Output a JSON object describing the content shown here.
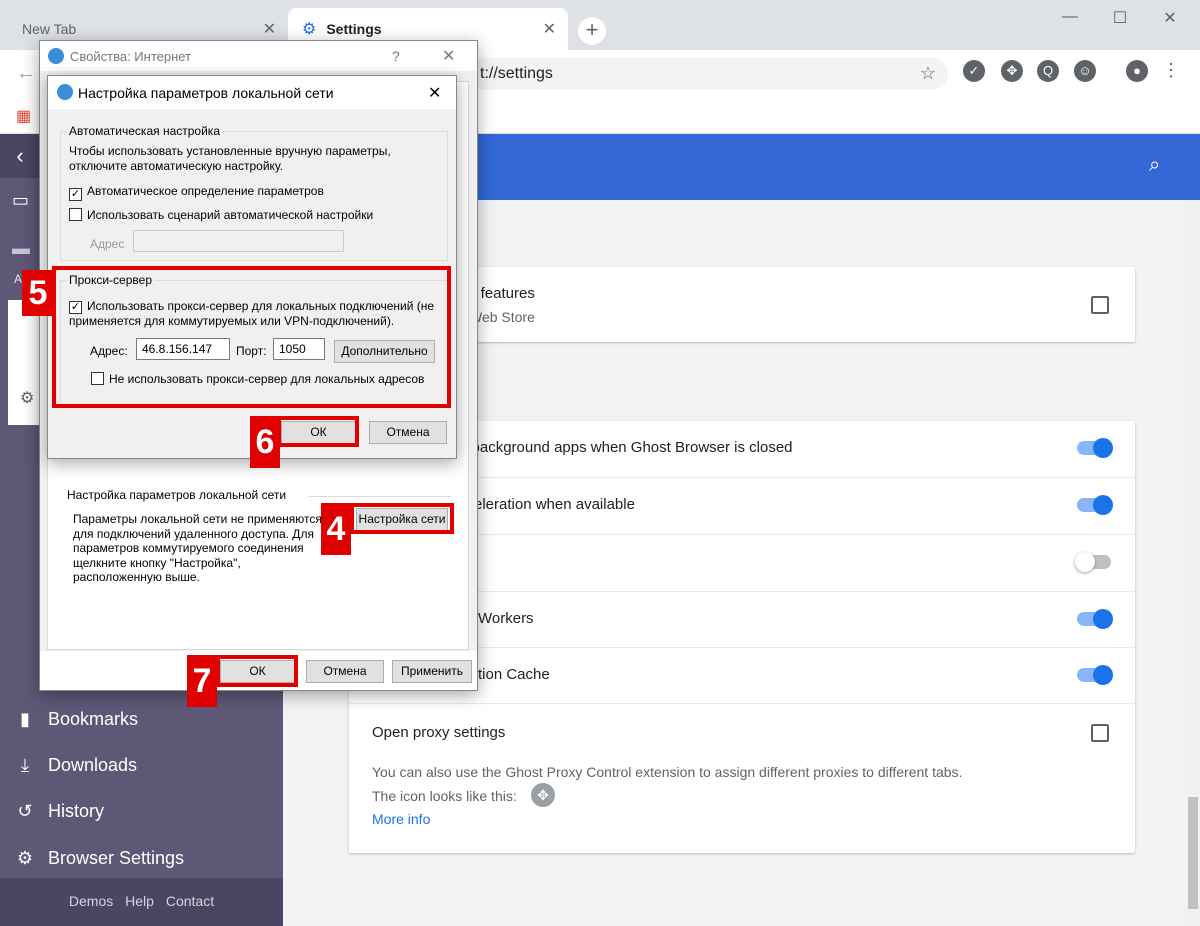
{
  "tabs": [
    {
      "label": "New Tab"
    },
    {
      "label": "Settings"
    }
  ],
  "omnibox": {
    "url": "t://settings"
  },
  "sidebar": {
    "items": [
      {
        "label": "Bookmarks",
        "icon": "bookmark-icon"
      },
      {
        "label": "Downloads",
        "icon": "download-icon"
      },
      {
        "label": "History",
        "icon": "history-icon"
      },
      {
        "label": "Browser Settings",
        "icon": "gear-icon"
      }
    ],
    "partial_label": "Al",
    "footer": [
      "Demos",
      "Help",
      "Contact"
    ]
  },
  "settings": {
    "extensions_card": {
      "title": "y features",
      "subtitle": "Web Store"
    },
    "system_rows": [
      {
        "label": "g background apps when Ghost Browser is closed",
        "enabled": true
      },
      {
        "label": "cceleration when available",
        "enabled": true
      },
      {
        "label": "",
        "enabled": false
      },
      {
        "label": "Workers",
        "enabled": true
      },
      {
        "label": "tion Cache",
        "enabled": true
      }
    ],
    "proxy": {
      "title": "Open proxy settings",
      "desc1": "You can also use the Ghost Proxy Control extension to assign different proxies to different tabs.",
      "desc2": "The icon looks like this:",
      "more_info": "More info"
    }
  },
  "inet_dialog": {
    "title": "Свойства: Интернет",
    "help": "?",
    "lan_group_label": "Настройка параметров локальной сети",
    "lan_desc": "Параметры локальной сети не применяются для подключений удаленного доступа. Для параметров коммутируемого соединения щелкните кнопку \"Настройка\", расположенную выше.",
    "lan_button": "Настройка сети",
    "ok": "ОК",
    "cancel": "Отмена",
    "apply": "Применить"
  },
  "lan_dialog": {
    "title": "Настройка параметров локальной сети",
    "auto_group": "Автоматическая настройка",
    "auto_desc": "Чтобы использовать установленные вручную параметры, отключите автоматическую настройку.",
    "auto_detect": {
      "label": "Автоматическое определение параметров",
      "checked": true
    },
    "auto_script": {
      "label": "Использовать сценарий автоматической настройки",
      "checked": false
    },
    "address_label": "Адрес",
    "proxy_group": "Прокси-сервер",
    "use_proxy": {
      "label": "Использовать прокси-сервер для локальных подключений (не применяется для коммутируемых или VPN-подключений).",
      "checked": true
    },
    "proxy_address_label": "Адрес:",
    "proxy_address": "46.8.156.147",
    "port_label": "Порт:",
    "port": "1050",
    "advanced": "Дополнительно",
    "bypass_local": {
      "label": "Не использовать прокси-сервер для локальных адресов",
      "checked": false
    },
    "ok": "ОК",
    "cancel": "Отмена"
  },
  "step_badges": [
    "5",
    "6",
    "4",
    "7"
  ],
  "colors": {
    "accent": "#3367d6",
    "sidebar": "#5e5877",
    "highlight": "#e00000",
    "toggle_on": "#1a73e8"
  }
}
